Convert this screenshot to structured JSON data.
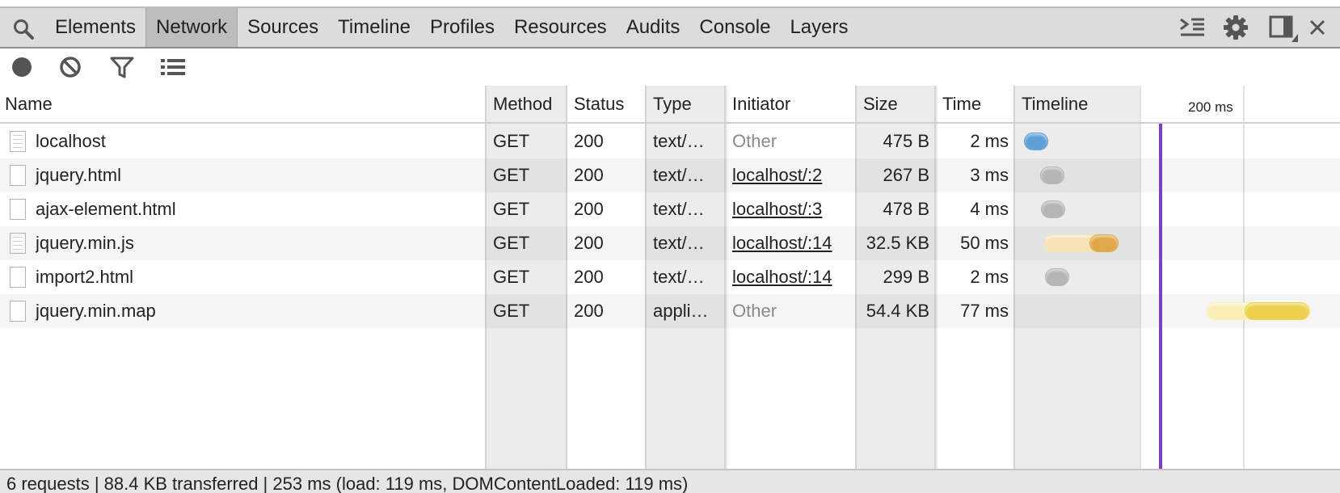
{
  "tabs": [
    {
      "label": "Elements"
    },
    {
      "label": "Network",
      "active": true
    },
    {
      "label": "Sources"
    },
    {
      "label": "Timeline"
    },
    {
      "label": "Profiles"
    },
    {
      "label": "Resources"
    },
    {
      "label": "Audits"
    },
    {
      "label": "Console"
    },
    {
      "label": "Layers"
    }
  ],
  "tabbar_icons": [
    "search-icon",
    "console-drawer-icon",
    "gear-icon",
    "dock-side-icon",
    "close-icon"
  ],
  "toolbar_icons": [
    "record-icon",
    "clear-icon",
    "filter-icon",
    "large-rows-icon"
  ],
  "columns": {
    "name": "Name",
    "method": "Method",
    "status": "Status",
    "type": "Type",
    "initiator": "Initiator",
    "size": "Size",
    "time": "Time",
    "timeline": "Timeline",
    "timeline_marker": "200 ms"
  },
  "rows": [
    {
      "name": "localhost",
      "method": "GET",
      "status": "200",
      "type": "text/…",
      "initiator": "Other",
      "initiator_is_link": false,
      "size": "475 B",
      "time": "2 ms",
      "icon": "document-icon",
      "timeline_color": "blue"
    },
    {
      "name": "jquery.html",
      "method": "GET",
      "status": "200",
      "type": "text/…",
      "initiator": "localhost/:2",
      "initiator_is_link": true,
      "size": "267 B",
      "time": "3 ms",
      "icon": "file-icon",
      "timeline_color": "gray"
    },
    {
      "name": "ajax-element.html",
      "method": "GET",
      "status": "200",
      "type": "text/…",
      "initiator": "localhost/:3",
      "initiator_is_link": true,
      "size": "478 B",
      "time": "4 ms",
      "icon": "file-icon",
      "timeline_color": "gray"
    },
    {
      "name": "jquery.min.js",
      "method": "GET",
      "status": "200",
      "type": "text/…",
      "initiator": "localhost/:14",
      "initiator_is_link": true,
      "size": "32.5 KB",
      "time": "50 ms",
      "icon": "document-icon",
      "timeline_color": "orange"
    },
    {
      "name": "import2.html",
      "method": "GET",
      "status": "200",
      "type": "text/…",
      "initiator": "localhost/:14",
      "initiator_is_link": true,
      "size": "299 B",
      "time": "2 ms",
      "icon": "file-icon",
      "timeline_color": "gray"
    },
    {
      "name": "jquery.min.map",
      "method": "GET",
      "status": "200",
      "type": "appli…",
      "initiator": "Other",
      "initiator_is_link": false,
      "size": "54.4 KB",
      "time": "77 ms",
      "icon": "file-icon",
      "timeline_color": "yellow"
    }
  ],
  "status_bar": "6 requests | 88.4 KB transferred | 253 ms (load: 119 ms, DOMContentLoaded: 119 ms)",
  "colors": {
    "load_line": "#7e3fbd",
    "blue": "#6fa8dc",
    "gray": "#bdbdbd",
    "orange": "#e0a84a",
    "yellow": "#f0d45a"
  }
}
